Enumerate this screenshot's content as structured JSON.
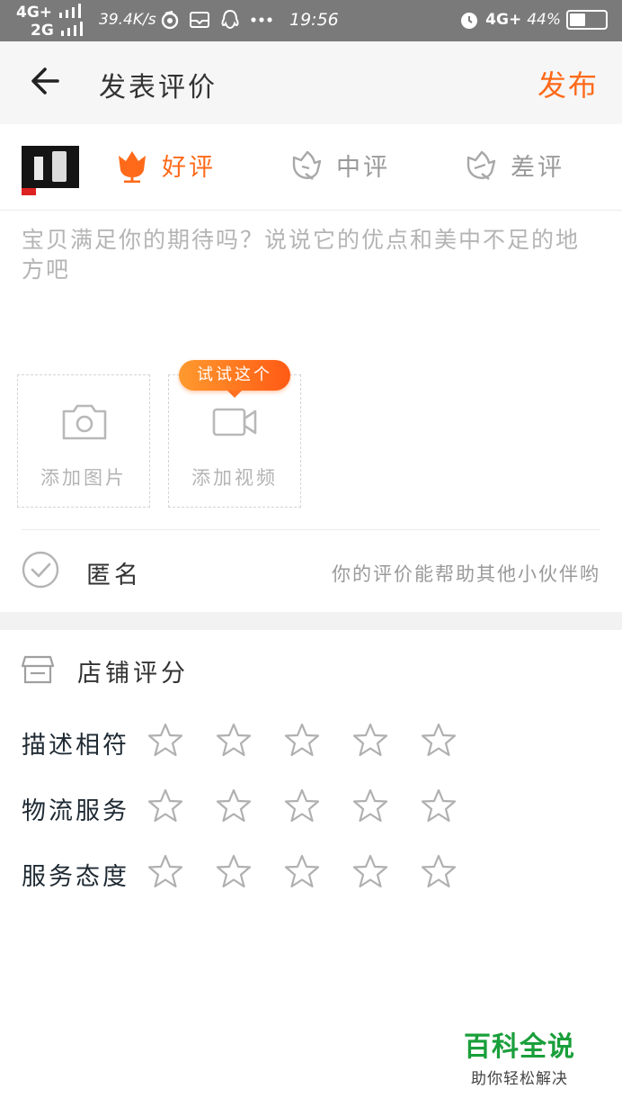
{
  "status_bar": {
    "network_1": "4G+",
    "network_2": "2G",
    "speed": "39.4K/s",
    "time": "19:56",
    "right_network": "4G+",
    "battery_text": "44%",
    "battery_level": 0.44
  },
  "header": {
    "title": "发表评价",
    "publish_label": "发布"
  },
  "rating": {
    "options": [
      {
        "label": "好评",
        "selected": true
      },
      {
        "label": "中评",
        "selected": false
      },
      {
        "label": "差评",
        "selected": false
      }
    ]
  },
  "comment": {
    "placeholder": "宝贝满足你的期待吗？说说它的优点和美中不足的地方吧"
  },
  "media": {
    "add_photo_label": "添加图片",
    "add_video_label": "添加视频",
    "tip_label": "试试这个"
  },
  "anonymous": {
    "label": "匿名",
    "hint": "你的评价能帮助其他小伙伴哟"
  },
  "shop_rating": {
    "title": "店铺评分",
    "rows": [
      {
        "label": "描述相符",
        "stars": 0,
        "max": 5
      },
      {
        "label": "物流服务",
        "stars": 0,
        "max": 5
      },
      {
        "label": "服务态度",
        "stars": 0,
        "max": 5
      }
    ]
  },
  "watermark": {
    "line1": "百科全说",
    "line2": "助你轻松解决"
  },
  "colors": {
    "accent": "#ff6a1a",
    "status_bar": "#7a7a7a",
    "inactive": "#9a9a9a",
    "watermark_green": "#1a9f3b"
  }
}
